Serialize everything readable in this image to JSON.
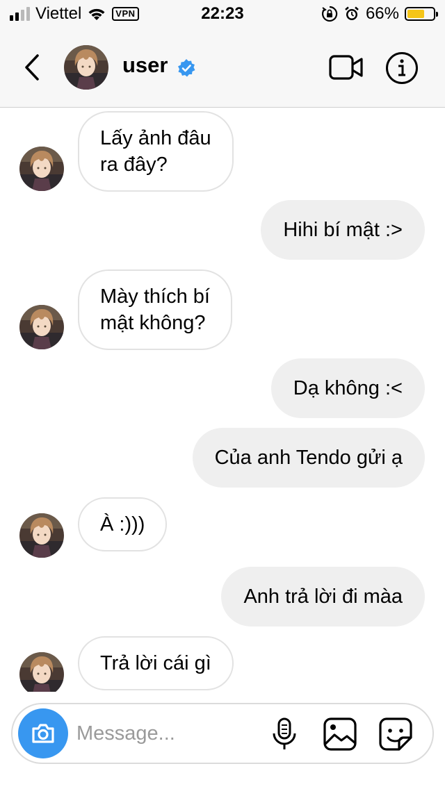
{
  "status_bar": {
    "carrier": "Viettel",
    "vpn": "VPN",
    "time": "22:23",
    "battery_text": "66%",
    "battery_level": 0.66,
    "signal_bars_filled": 2,
    "signal_bars_total": 4
  },
  "header": {
    "username": "user",
    "verified": true
  },
  "messages": [
    {
      "from": "them",
      "lines": [
        "Lấy ảnh đâu",
        "ra đây?"
      ]
    },
    {
      "from": "me",
      "lines": [
        "Hihi bí mật :>"
      ]
    },
    {
      "from": "them",
      "lines": [
        "Mày thích bí",
        "mật không?"
      ]
    },
    {
      "from": "me",
      "lines": [
        "Dạ không :<"
      ]
    },
    {
      "from": "me",
      "lines": [
        "Của anh Tendo gửi ạ"
      ]
    },
    {
      "from": "them",
      "lines": [
        "À :)))"
      ]
    },
    {
      "from": "me",
      "lines": [
        "Anh trả lời đi màa"
      ]
    },
    {
      "from": "them",
      "lines": [
        "Trả lời cái gì"
      ]
    }
  ],
  "composer": {
    "placeholder": "Message..."
  },
  "colors": {
    "accent_blue": "#3897f0",
    "out_bubble": "#efefef",
    "in_bubble_border": "#e2e2e2",
    "battery_fill": "#f5c518"
  }
}
